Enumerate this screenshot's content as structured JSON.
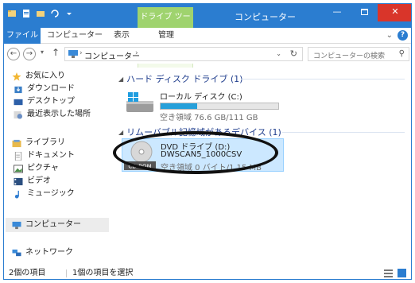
{
  "window": {
    "title": "コンピューター",
    "context_tab": "ドライブ ツール",
    "minimize": "—",
    "close": "✕"
  },
  "ribbon": {
    "tabs": [
      "ファイル",
      "コンピューター",
      "表示",
      "管理"
    ],
    "collapse": "⌄",
    "help": "?"
  },
  "nav": {
    "back": "←",
    "forward": "→",
    "recent": "▾",
    "up": "↑",
    "breadcrumb": "コンピューター",
    "crumb_sep": "›",
    "dropdown": "⌄",
    "refresh": "↻",
    "search_placeholder": "コンピューターの検索",
    "search_icon": "⚲"
  },
  "navpane": {
    "favorites": "お気に入り",
    "downloads": "ダウンロード",
    "desktop": "デスクトップ",
    "recent": "最近表示した場所",
    "libraries": "ライブラリ",
    "documents": "ドキュメント",
    "pictures": "ピクチャ",
    "videos": "ビデオ",
    "music": "ミュージック",
    "computer": "コンピューター",
    "network": "ネットワーク"
  },
  "groups": {
    "hdd_header": "ハード ディスク ドライブ (1)",
    "removable_header": "リムーバブル記憶域があるデバイス (1)",
    "collapse_icon": "◢"
  },
  "local_disk": {
    "name": "ローカル ディスク (C:)",
    "free_text": "空き領域 76.6 GB/111 GB",
    "used_fraction": 0.31
  },
  "dvd": {
    "name": "DVD ドライブ (D:)",
    "label": "DWSCAN5_1000CSV",
    "free_text": "空き領域 0 バイト/1.15 MB",
    "badge": "CD-ROM"
  },
  "status": {
    "items": "2個の項目",
    "selected": "1個の項目を選択"
  },
  "colors": {
    "accent": "#2b7dd0",
    "context_tab": "#9fd36e",
    "selection": "#cce8ff",
    "bar_fill": "#26a0da",
    "close": "#d9352a"
  }
}
